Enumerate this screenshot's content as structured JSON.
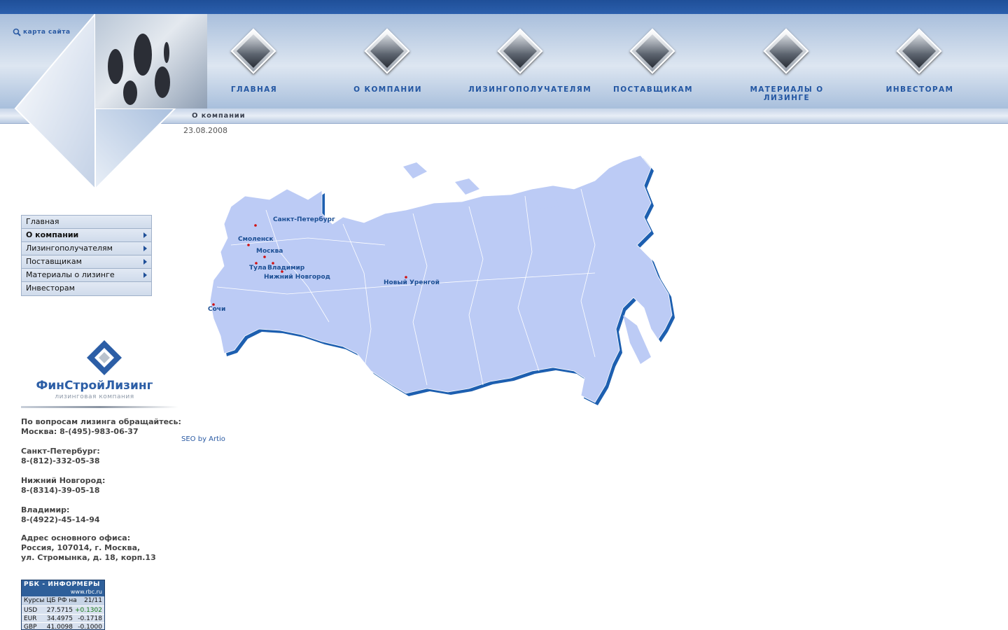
{
  "header": {
    "sitemap_label": "карта сайта",
    "nav": [
      {
        "label": "ГЛАВНАЯ"
      },
      {
        "label": "О КОМПАНИИ"
      },
      {
        "label": "ЛИЗИНГОПОЛУЧАТЕЛЯМ"
      },
      {
        "label": "ПОСТАВЩИКАМ"
      },
      {
        "label": "МАТЕРИАЛЫ О ЛИЗИНГЕ"
      },
      {
        "label": "ИНВЕСТОРАМ"
      }
    ]
  },
  "breadcrumb": "О компании",
  "date": "23.08.2008",
  "sidebar": {
    "items": [
      {
        "label": "Главная"
      },
      {
        "label": "О компании"
      },
      {
        "label": "Лизингополучателям"
      },
      {
        "label": "Поставщикам"
      },
      {
        "label": "Материалы о лизинге"
      },
      {
        "label": "Инвесторам"
      }
    ]
  },
  "logo": {
    "name": "ФинСтройЛизинг",
    "subtitle": "лизинговая компания"
  },
  "contacts": {
    "intro": "По вопросам лизинга обращайтесь:",
    "moscow": "Москва: 8-(495)-983-06-37",
    "spb_label": "Санкт-Петербург:",
    "spb_phone": "8-(812)-332-05-38",
    "nn_label": "Нижний Новгород:",
    "nn_phone": "8-(8314)-39-05-18",
    "vl_label": "Владимир:",
    "vl_phone": "8-(4922)-45-14-94",
    "office_label": "Адрес основного офиса:",
    "office_line1": "Россия, 107014, г. Москва,",
    "office_line2": "ул. Стромынка, д. 18, корп.13"
  },
  "seo_link": "SEO by Artio",
  "map": {
    "cities": [
      {
        "name": "Санкт-Петербург"
      },
      {
        "name": "Смоленск"
      },
      {
        "name": "Москва"
      },
      {
        "name": "Тула"
      },
      {
        "name": "Владимир"
      },
      {
        "name": "Нижний Новгород"
      },
      {
        "name": "Новый Уренгой"
      },
      {
        "name": "Сочи"
      }
    ]
  },
  "informer": {
    "title": "РБК - ИНФОРМЕРЫ",
    "site": "www.rbc.ru",
    "caption": "Курсы ЦБ РФ на",
    "date": "21/11",
    "rates": [
      {
        "code": "USD",
        "value": "27.5715",
        "change": "+0.1302"
      },
      {
        "code": "EUR",
        "value": "34.4975",
        "change": "-0.1718"
      },
      {
        "code": "GBP",
        "value": "41.0098",
        "change": "-0.1000"
      }
    ]
  },
  "colors": {
    "accent": "#2356a2",
    "topbar": "#1f4f98",
    "map_fill": "#bccbf5",
    "map_shadow": "#1d5fb0"
  }
}
